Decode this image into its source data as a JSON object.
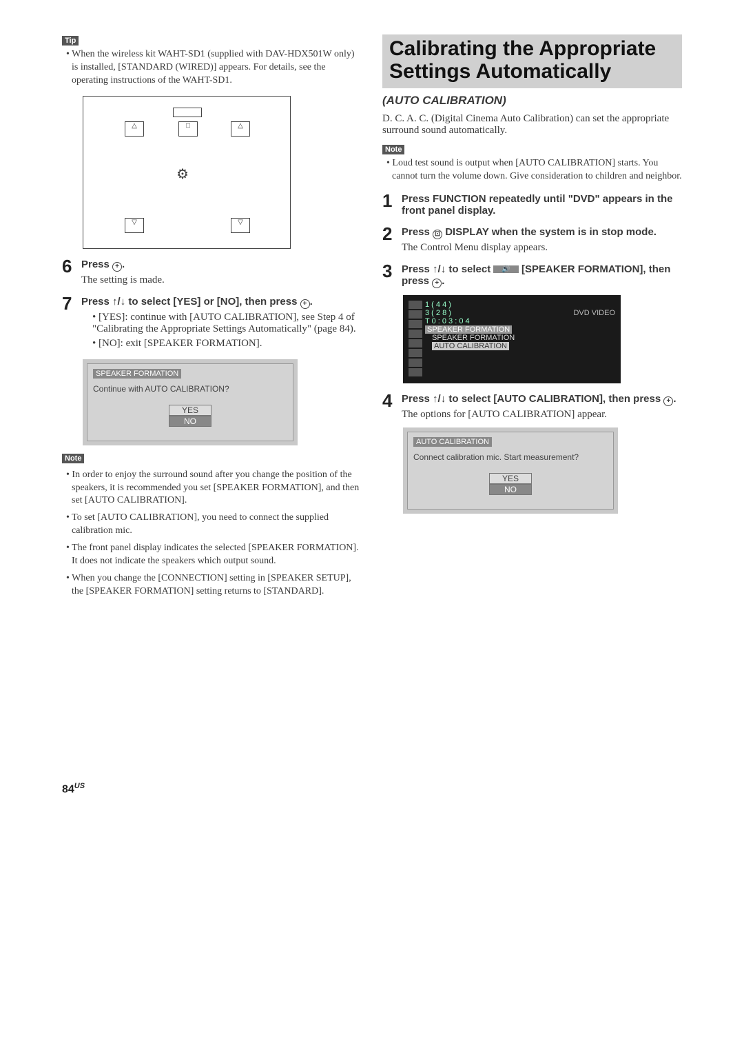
{
  "left": {
    "tip_badge": "Tip",
    "tip_text": "When the wireless kit WAHT-SD1 (supplied with DAV-HDX501W only) is installed, [STANDARD (WIRED)] appears. For details, see the operating instructions of the WAHT-SD1.",
    "step6": {
      "num": "6",
      "head_a": "Press ",
      "head_b": ".",
      "sub": "The setting is made."
    },
    "step7": {
      "num": "7",
      "head_a": "Press ↑/↓ to select [YES] or [NO], then press ",
      "head_b": ".",
      "bullet_yes": "[YES]: continue with [AUTO CALIBRATION], see Step 4 of \"Calibrating the Appropriate Settings Automatically\" (page 84).",
      "bullet_no": "[NO]: exit [SPEAKER FORMATION]."
    },
    "osd1": {
      "title": "SPEAKER FORMATION",
      "prompt": "Continue with AUTO CALIBRATION?",
      "yes": "YES",
      "no": "NO"
    },
    "note_badge": "Note",
    "notes": [
      "In order to enjoy the surround sound after you change the position of the speakers, it is recommended you set [SPEAKER FORMATION], and then set [AUTO CALIBRATION].",
      "To set [AUTO CALIBRATION], you need to connect the supplied calibration mic.",
      "The front panel display indicates the selected [SPEAKER FORMATION]. It does not indicate the speakers which output sound.",
      "When you change the [CONNECTION] setting in [SPEAKER SETUP], the [SPEAKER FORMATION] setting returns to [STANDARD]."
    ]
  },
  "right": {
    "title": "Calibrating the Appropriate Settings Automatically",
    "subtitle": "(AUTO CALIBRATION)",
    "intro": "D. C. A. C. (Digital Cinema Auto Calibration) can set the appropriate surround sound automatically.",
    "note_badge": "Note",
    "note_text": "Loud test sound is output when [AUTO CALIBRATION] starts. You cannot turn the volume down. Give consideration to children and neighbor.",
    "step1": {
      "num": "1",
      "head": "Press FUNCTION repeatedly until \"DVD\" appears in the front panel display."
    },
    "step2": {
      "num": "2",
      "head_a": "Press ",
      "head_b": " DISPLAY when the system is in stop mode.",
      "sub": "The Control Menu display appears."
    },
    "step3": {
      "num": "3",
      "head_a": "Press ↑/↓ to select ",
      "head_b": " [SPEAKER FORMATION], then press ",
      "head_c": "."
    },
    "menu": {
      "l1": "1 ( 4 4 )",
      "l2": "3 ( 2 8 )",
      "media": "DVD VIDEO",
      "time": "T     0 : 0 3 : 0 4",
      "i1": "SPEAKER FORMATION",
      "i2": "SPEAKER FORMATION",
      "i3": "AUTO CALIBRATION"
    },
    "step4": {
      "num": "4",
      "head_a": "Press ↑/↓ to select [AUTO CALIBRATION], then press ",
      "head_b": ".",
      "sub": "The options for [AUTO CALIBRATION] appear."
    },
    "osd2": {
      "title": "AUTO CALIBRATION",
      "prompt": "Connect calibration mic. Start measurement?",
      "yes": "YES",
      "no": "NO"
    }
  },
  "page": {
    "num": "84",
    "suffix": "US"
  }
}
